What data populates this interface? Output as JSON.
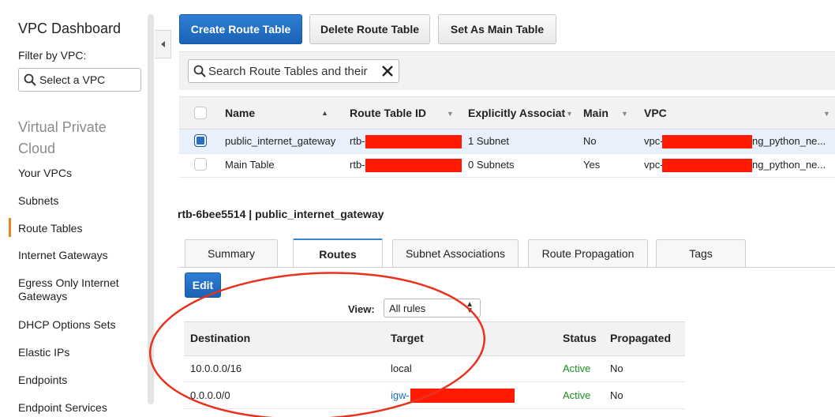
{
  "sidebar": {
    "title": "VPC Dashboard",
    "filter_label": "Filter by VPC:",
    "filter_placeholder": "Select a VPC",
    "section": "Virtual Private Cloud",
    "items": [
      {
        "label": "Your VPCs"
      },
      {
        "label": "Subnets"
      },
      {
        "label": "Route Tables"
      },
      {
        "label": "Internet Gateways"
      },
      {
        "label": "Egress Only Internet Gateways"
      },
      {
        "label": "DHCP Options Sets"
      },
      {
        "label": "Elastic IPs"
      },
      {
        "label": "Endpoints"
      },
      {
        "label": "Endpoint Services"
      }
    ],
    "active_item": "Route Tables",
    "active_color": "#e8871e"
  },
  "toolbar": {
    "create_label": "Create Route Table",
    "delete_label": "Delete Route Table",
    "set_main_label": "Set As Main Table"
  },
  "search": {
    "placeholder": "Search Route Tables and their"
  },
  "table": {
    "columns": [
      "Name",
      "Route Table ID",
      "Explicitly Associat",
      "Main",
      "VPC"
    ],
    "rows": [
      {
        "selected": true,
        "name": "public_internet_gateway",
        "id": "rtb-",
        "assoc": "1 Subnet",
        "main": "No",
        "vpc_prefix": "vpc-",
        "vpc_suffix": "ng_python_ne..."
      },
      {
        "selected": false,
        "name": "Main Table",
        "id": "rtb-",
        "assoc": "0 Subnets",
        "main": "Yes",
        "vpc_prefix": "vpc-",
        "vpc_suffix": "ng_python_ne..."
      }
    ]
  },
  "detail": {
    "title": "rtb-6bee5514 | public_internet_gateway",
    "tabs": [
      {
        "label": "Summary"
      },
      {
        "label": "Routes"
      },
      {
        "label": "Subnet Associations"
      },
      {
        "label": "Route Propagation"
      },
      {
        "label": "Tags"
      }
    ],
    "active_tab": "Routes",
    "edit_label": "Edit",
    "view_label": "View:",
    "view_value": "All rules"
  },
  "routes": {
    "columns": [
      "Destination",
      "Target",
      "Status",
      "Propagated"
    ],
    "rows": [
      {
        "destination": "10.0.0.0/16",
        "target": "local",
        "status": "Active",
        "propagated": "No"
      },
      {
        "destination": "0.0.0.0/0",
        "target": "igw-",
        "status": "Active",
        "propagated": "No"
      }
    ]
  },
  "colors": {
    "primary": "#1a62b5",
    "redaction": "#ff1a00",
    "annotation": "#e8321e",
    "active_status": "#1f8b24",
    "link": "#1a6fc2"
  }
}
